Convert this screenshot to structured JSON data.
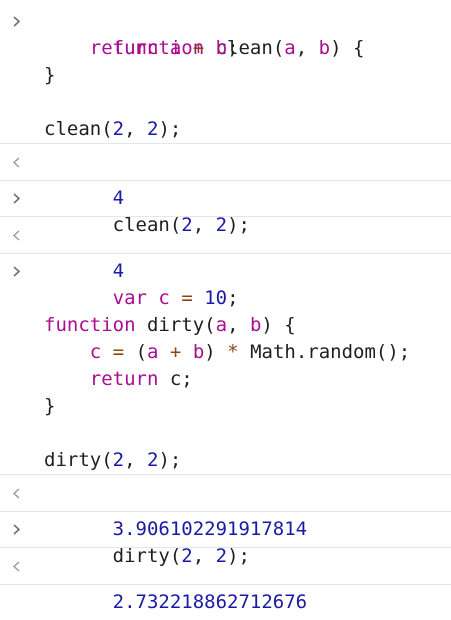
{
  "entries": [
    {
      "kind": "input",
      "lines": [
        "function clean(a, b) {",
        "    return a + b;",
        "}",
        "",
        "clean(2, 2);"
      ]
    },
    {
      "kind": "result",
      "value": "4"
    },
    {
      "kind": "input",
      "lines": [
        "clean(2, 2);"
      ]
    },
    {
      "kind": "result",
      "value": "4"
    },
    {
      "kind": "input",
      "lines": [
        "var c = 10;",
        "",
        "function dirty(a, b) {",
        "    c = (a + b) * Math.random();",
        "    return c;",
        "}",
        "",
        "dirty(2, 2);"
      ]
    },
    {
      "kind": "result",
      "value": "3.906102291917814"
    },
    {
      "kind": "input",
      "lines": [
        "dirty(2, 2);"
      ]
    },
    {
      "kind": "result",
      "value": "2.732218862712676"
    }
  ],
  "icons": {
    "input_prompt": "chevron-right-icon",
    "result_prompt": "chevron-left-icon"
  }
}
